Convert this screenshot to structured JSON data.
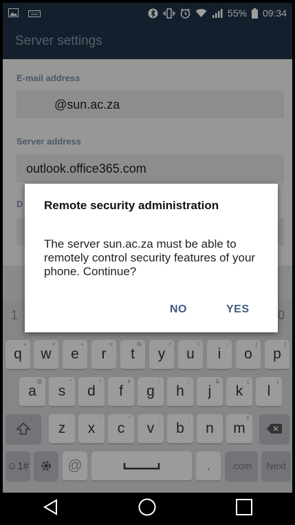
{
  "status_bar": {
    "battery_percent": "55%",
    "time": "09:34",
    "icons": [
      "image-icon",
      "keyboard-icon",
      "bluetooth-icon",
      "vibrate-icon",
      "alarm-icon",
      "wifi-icon",
      "signal-icon",
      "battery-icon"
    ]
  },
  "app_bar": {
    "title": "Server settings"
  },
  "form": {
    "email_label": "E-mail address",
    "email_value": "@sun.ac.za",
    "server_label": "Server address",
    "server_value": "outlook.office365.com",
    "domain_label_partial": "D"
  },
  "dialog": {
    "title": "Remote security administration",
    "message": "The server sun.ac.za must be able to remotely control security features of your phone. Continue?",
    "no_label": "NO",
    "yes_label": "YES"
  },
  "keyboard": {
    "row_numbers_left": "1",
    "row_numbers_right": "0",
    "row1": [
      "q",
      "w",
      "e",
      "r",
      "t",
      "y",
      "u",
      "i",
      "o",
      "p"
    ],
    "row1_hints": [
      "+",
      "×",
      "÷",
      "=",
      "%",
      "/",
      "\\",
      "-",
      "[",
      "]"
    ],
    "row2": [
      "a",
      "s",
      "d",
      "f",
      "g",
      "h",
      "j",
      "k",
      "l"
    ],
    "row2_hints": [
      "@",
      "*",
      "!",
      "#",
      ":",
      ";",
      "&",
      "(",
      ")"
    ],
    "row3": [
      "z",
      "x",
      "c",
      "v",
      "b",
      "n",
      "m"
    ],
    "row3_hints": [
      "-",
      "'",
      "\"",
      ":",
      ";",
      ",",
      "?"
    ],
    "symbols_label": "☺1#",
    "dotcom_label": ".com",
    "next_label": "Next",
    "period_label": ".",
    "at_label": "@"
  },
  "colors": {
    "app_bar": "#1f3248",
    "label": "#7c8fa8",
    "dialog_button": "#3d5a80"
  }
}
